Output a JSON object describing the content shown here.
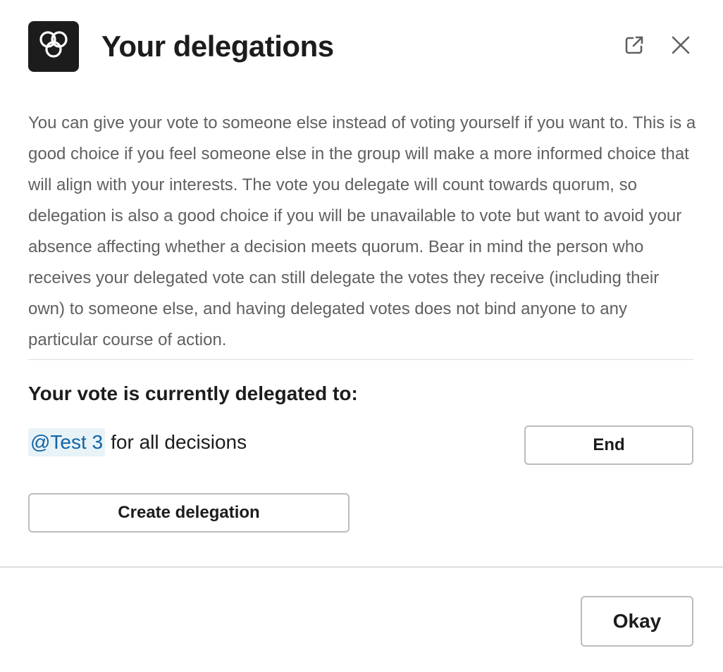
{
  "header": {
    "title": "Your delegations",
    "logo_icon": "three-loops-logo-icon",
    "open_icon": "open-in-new-window-icon",
    "close_icon": "close-icon"
  },
  "description": "You can give your vote to someone else instead of voting yourself if you want to. This is a good choice if you feel someone else in the group will make a more informed choice that will align with your interests. The vote you delegate will count towards quorum, so delegation is also a good choice if you will be unavailable to vote but want to avoid your absence affecting whether a decision meets quorum. Bear in mind the person who receives your delegated vote can still delegate the votes they receive (including their own) to someone else, and having delegated votes does not bind anyone to any particular course of action.",
  "current_delegation": {
    "heading": "Your vote is currently delegated to:",
    "delegate_mention": "@Test 3",
    "scope_text": "for all decisions",
    "end_label": "End"
  },
  "create_label": "Create delegation",
  "footer": {
    "okay_label": "Okay"
  },
  "colors": {
    "text": "#1d1c1d",
    "muted_text": "#616061",
    "mention_text": "#1264a3",
    "mention_bg": "#e8f3f8",
    "border": "#bcbcbc",
    "logo_bg": "#1d1c1d"
  }
}
